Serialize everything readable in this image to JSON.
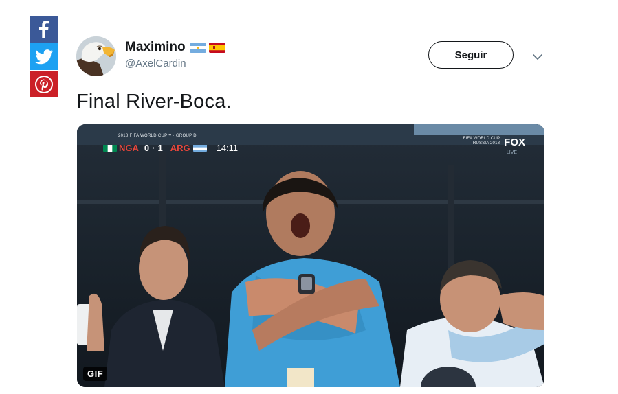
{
  "share_bar": {
    "buttons": [
      {
        "network": "facebook",
        "icon": "facebook-icon",
        "color": "#3b5998"
      },
      {
        "network": "twitter",
        "icon": "twitter-icon",
        "color": "#1da1f2"
      },
      {
        "network": "pinterest",
        "icon": "pinterest-icon",
        "color": "#cb2027"
      }
    ]
  },
  "tweet": {
    "author": {
      "name": "Maximino",
      "handle": "@AxelCardin",
      "flags": [
        "argentina-flag",
        "spain-flag"
      ]
    },
    "follow_label": "Seguir",
    "text": "Final River-Boca.",
    "media": {
      "type_badge": "GIF",
      "competition_label": "2018 FIFA WORLD CUP™ · GROUP D",
      "home_team": "NGA",
      "home_score": "0",
      "away_score": "1",
      "away_team": "ARG",
      "clock": "14:11",
      "broadcast_line1": "FIFA WORLD CUP",
      "broadcast_line2": "RUSSIA 2018",
      "broadcaster": "FOX",
      "live_label": "LIVE"
    }
  },
  "colors": {
    "accent_text": "#14171a",
    "secondary_text": "#657786",
    "scoreboard_team": "#e8463b"
  }
}
